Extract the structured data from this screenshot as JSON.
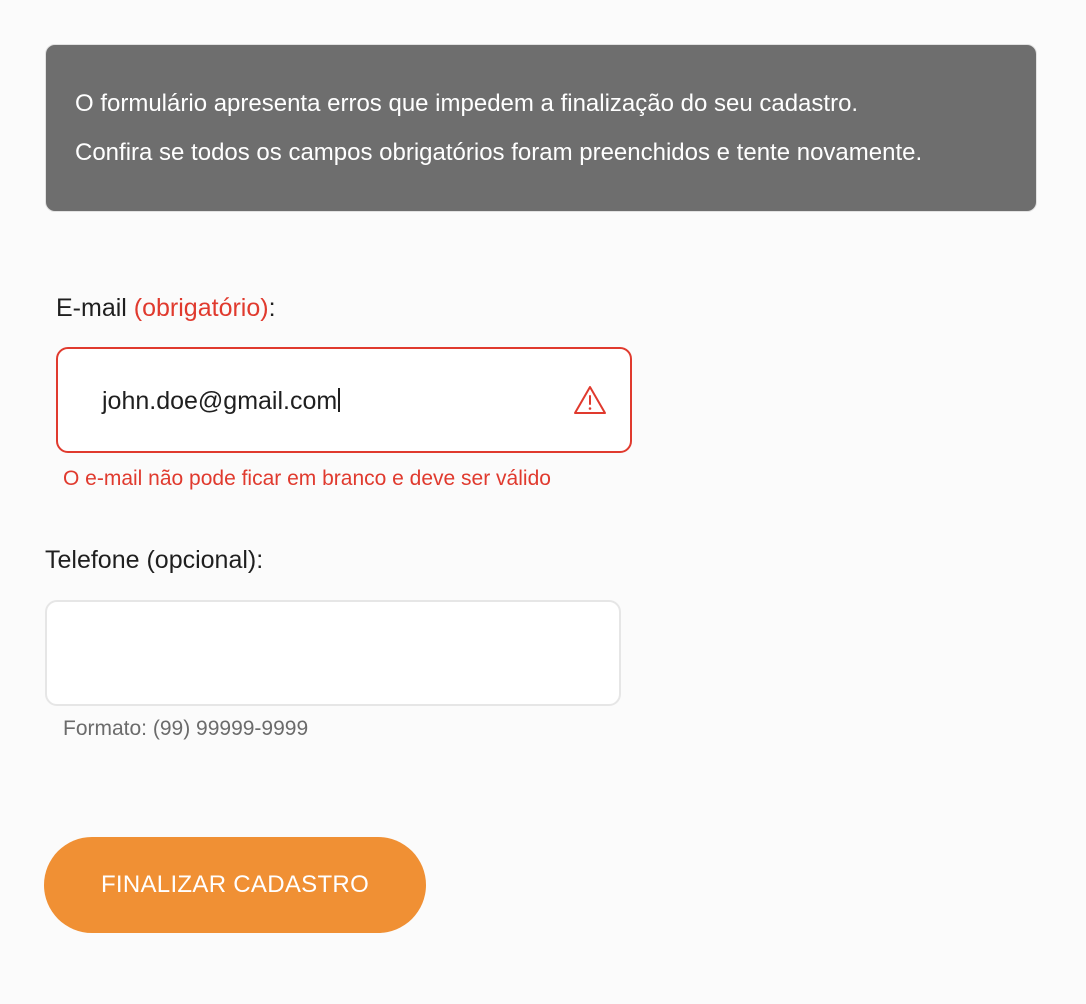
{
  "banner": {
    "line1": "O formulário apresenta erros que impedem a finalização do seu cadastro.",
    "line2": "Confira se todos os campos obrigatórios foram preenchidos e tente novamente."
  },
  "email": {
    "label": "E-mail ",
    "required": "(obrigatório)",
    "colon": ":",
    "value": "john.doe@gmail.com",
    "error": "O e-mail não pode ficar em branco e deve ser válido",
    "icon": "warning-triangle-icon"
  },
  "phone": {
    "label": "Telefone (opcional):",
    "value": "",
    "hint": "Formato: (99) 99999-9999"
  },
  "submit": {
    "label": "FINALIZAR CADASTRO"
  },
  "colors": {
    "banner_bg": "#6e6e6e",
    "error": "#e03a2e",
    "accent": "#f09034"
  }
}
